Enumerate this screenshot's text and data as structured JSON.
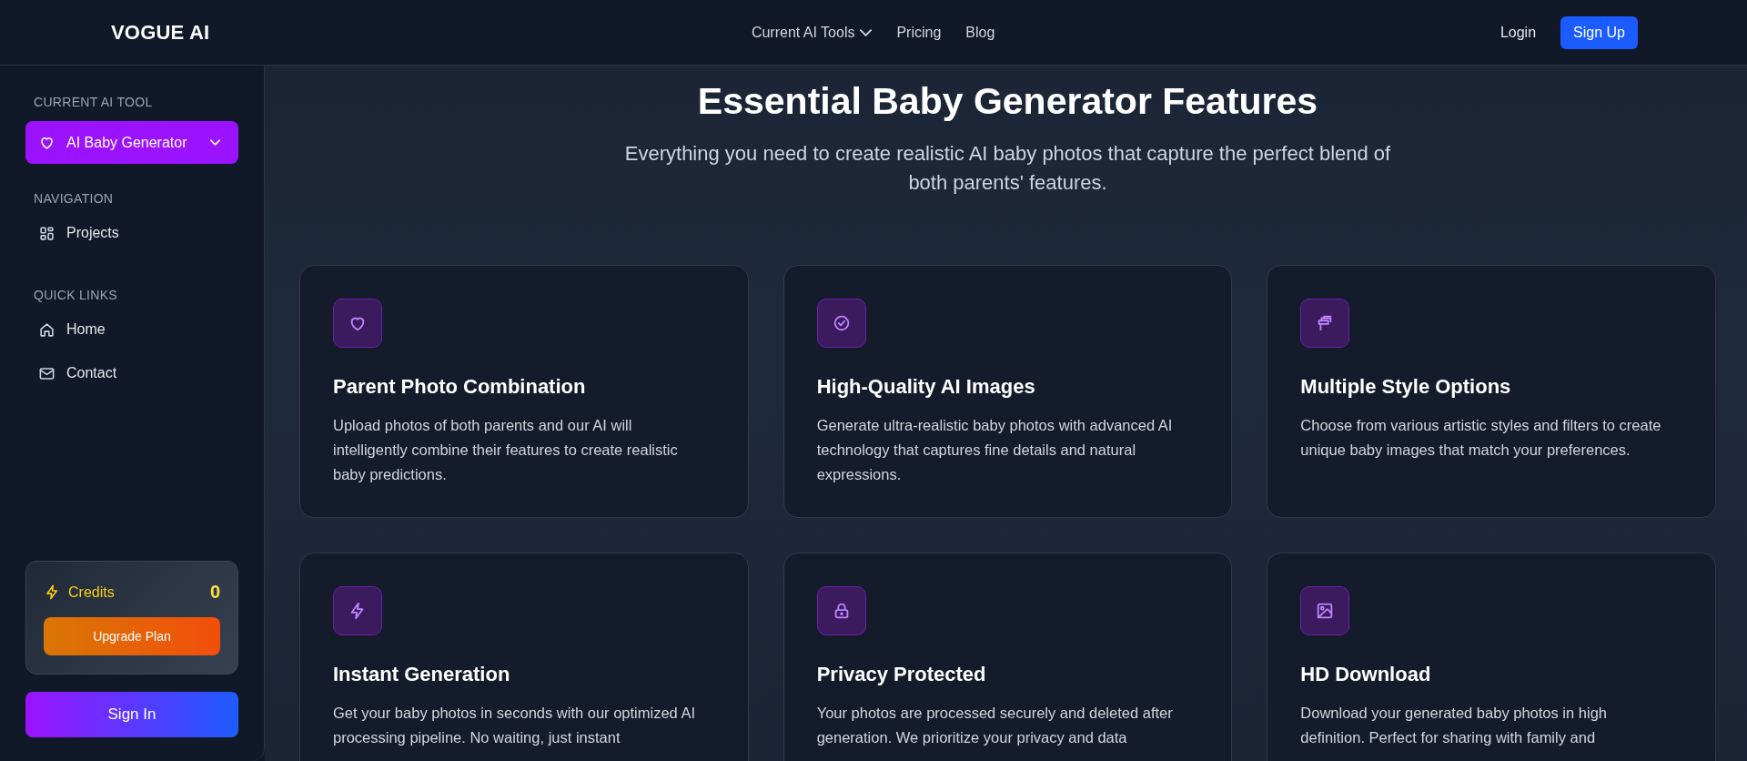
{
  "header": {
    "logo": "VOGUE AI",
    "nav": [
      {
        "label": "Current AI Tools",
        "kind": "dropdown"
      },
      {
        "label": "Pricing",
        "kind": "link"
      },
      {
        "label": "Blog",
        "kind": "link"
      }
    ],
    "login": "Login",
    "signup": "Sign Up"
  },
  "sidebar": {
    "tool_label": "CURRENT AI TOOL",
    "tool": {
      "label": "AI Baby Generator"
    },
    "sections": [
      {
        "title": "NAVIGATION",
        "items": [
          {
            "label": "Projects"
          }
        ]
      },
      {
        "title": "QUICK LINKS",
        "items": [
          {
            "label": "Home"
          },
          {
            "label": "Contact"
          }
        ]
      }
    ],
    "credits": {
      "label": "Credits",
      "value": "0",
      "button": "Upgrade Plan"
    },
    "sign_in": "Sign In"
  },
  "main": {
    "title": "Essential Baby Generator Features",
    "subtitle": "Everything you need to create realistic AI baby photos that capture the perfect blend of both parents' features.",
    "features": [
      {
        "title": "Parent Photo Combination",
        "text": "Upload photos of both parents and our AI will intelligently combine their features to create realistic baby predictions."
      },
      {
        "title": "High-Quality AI Images",
        "text": "Generate ultra-realistic baby photos with advanced AI technology that captures fine details and natural expressions."
      },
      {
        "title": "Multiple Style Options",
        "text": "Choose from various artistic styles and filters to create unique baby images that match your preferences."
      },
      {
        "title": "Instant Generation",
        "text": "Get your baby photos in seconds with our optimized AI processing pipeline. No waiting, just instant"
      },
      {
        "title": "Privacy Protected",
        "text": "Your photos are processed securely and deleted after generation. We prioritize your privacy and data"
      },
      {
        "title": "HD Download",
        "text": "Download your generated baby photos in high definition. Perfect for sharing with family and"
      }
    ]
  }
}
